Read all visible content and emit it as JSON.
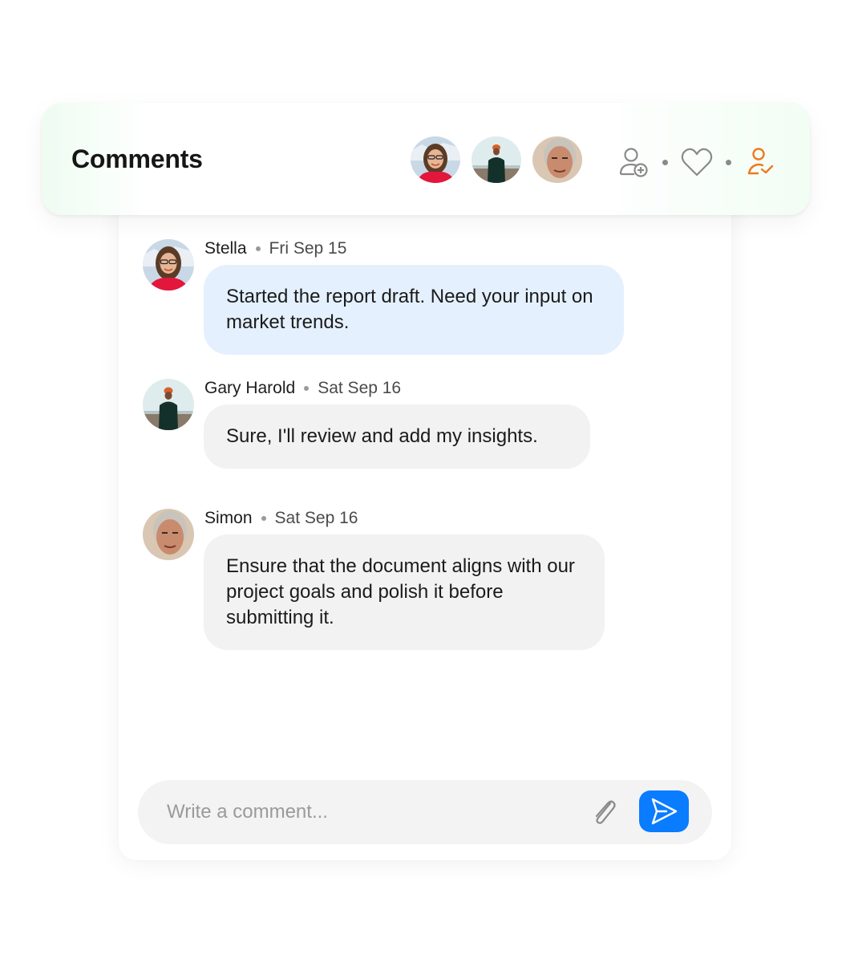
{
  "header": {
    "title": "Comments",
    "participants": [
      "Stella",
      "Gary Harold",
      "Simon"
    ],
    "actions": [
      {
        "name": "add-user",
        "icon": "user-plus-icon"
      },
      {
        "name": "like",
        "icon": "heart-icon"
      },
      {
        "name": "assign",
        "icon": "user-check-icon",
        "color": "#ee7a1d"
      }
    ]
  },
  "comments": [
    {
      "author": "Stella",
      "date": "Fri Sep 15",
      "text": "Started the report draft. Need your input on market trends.",
      "bubble_color": "#e4f0fd"
    },
    {
      "author": "Gary Harold",
      "date": "Sat Sep 16",
      "text": "Sure, I'll review and add my insights.",
      "bubble_color": "#f2f2f2"
    },
    {
      "author": "Simon",
      "date": "Sat Sep 16",
      "text": "Ensure that the document aligns with our project goals and polish it before submitting it.",
      "bubble_color": "#f2f2f2"
    }
  ],
  "composer": {
    "placeholder": "Write a comment...",
    "value": "",
    "attach_icon": "paperclip-icon",
    "send_icon": "send-icon",
    "send_color": "#0a7cff"
  }
}
